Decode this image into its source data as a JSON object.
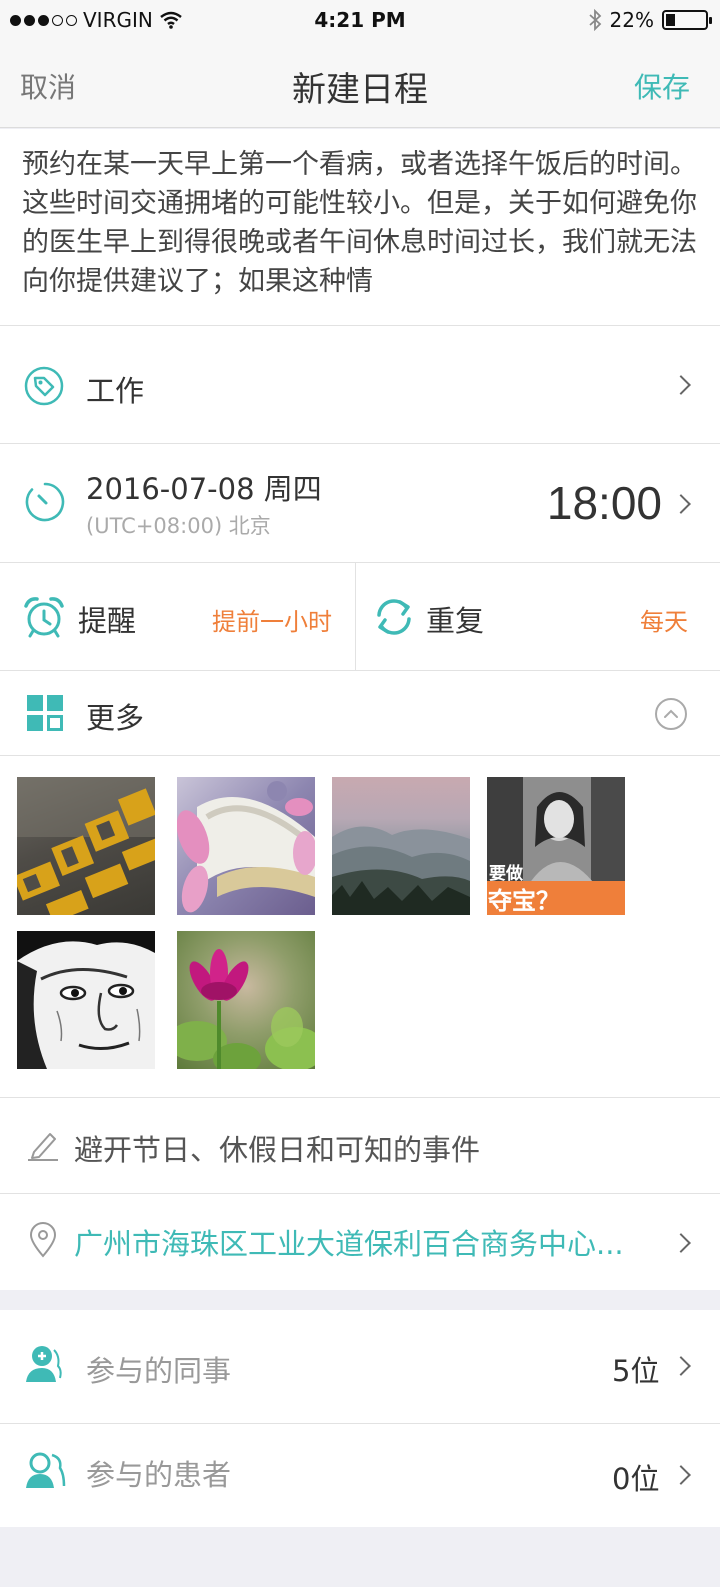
{
  "status_bar": {
    "carrier": "VIRGIN",
    "time": "4:21 PM",
    "battery": "22%",
    "battery_level": 0.22
  },
  "nav": {
    "cancel": "取消",
    "title": "新建日程",
    "save": "保存"
  },
  "description": "预约在某一天早上第一个看病，或者选择午饭后的时间。这些时间交通拥堵的可能性较小。但是，关于如何避免你的医生早上到得很晚或者午间休息时间过长，我们就无法向你提供建议了；如果这种情",
  "category": {
    "label": "工作",
    "icon": "tag-icon"
  },
  "datetime": {
    "date": "2016-07-08  周四",
    "timezone": "(UTC+08:00) 北京",
    "time": "18:00",
    "icon": "clock-icon"
  },
  "reminder": {
    "label": "提醒",
    "value": "提前一小时",
    "icon": "alarm-icon"
  },
  "repeat": {
    "label": "重复",
    "value": "每天",
    "icon": "repeat-icon"
  },
  "more": {
    "label": "更多",
    "icon": "grid-icon"
  },
  "photos": [
    {
      "name": "street-paint-photo",
      "overlay": ""
    },
    {
      "name": "flower-frame-photo",
      "overlay": ""
    },
    {
      "name": "mountains-photo",
      "overlay": ""
    },
    {
      "name": "woman-poster-photo",
      "overlay_small": "要做",
      "overlay_big": "夺宝？"
    },
    {
      "name": "portrait-sketch-photo",
      "overlay": ""
    },
    {
      "name": "pink-flower-photo",
      "overlay": ""
    }
  ],
  "note": {
    "text": "避开节日、休假日和可知的事件",
    "icon": "pencil-icon"
  },
  "location": {
    "text": "广州市海珠区工业大道保利百合商务中心...",
    "icon": "location-pin-icon"
  },
  "participants": {
    "colleagues": {
      "label": "参与的同事",
      "count": "5位",
      "icon": "doctor-icon"
    },
    "patients": {
      "label": "参与的患者",
      "count": "0位",
      "icon": "patients-icon"
    }
  },
  "colors": {
    "accent": "#3fbab6",
    "orange": "#ef7f3a"
  }
}
